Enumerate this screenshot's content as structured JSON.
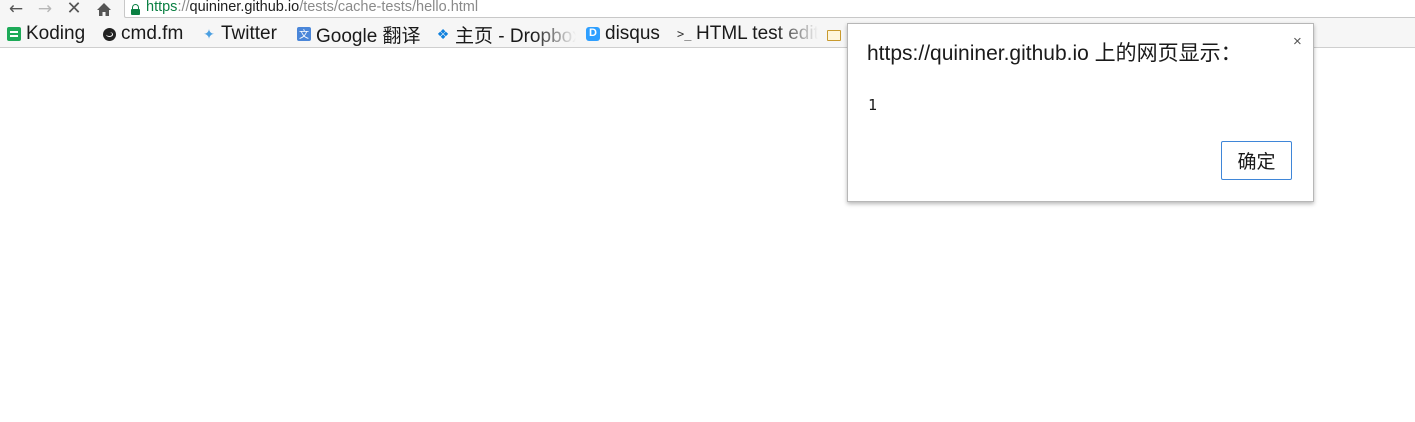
{
  "browser": {
    "nav": {
      "back_icon": "arrow-left-icon",
      "forward_icon": "arrow-right-icon",
      "stop_icon": "close-icon",
      "home_icon": "home-icon"
    },
    "omnibox": {
      "secure_icon": "lock-icon",
      "scheme": "https",
      "separator": "://",
      "host": "quininer.github.io",
      "path": "/tests/cache-tests/hello.html"
    },
    "bookmarks": [
      {
        "label": "Koding",
        "icon": "koding-icon"
      },
      {
        "label": "cmd.fm",
        "icon": "cmd-fm-icon"
      },
      {
        "label": "Twitter",
        "icon": "twitter-icon"
      },
      {
        "label": "Google 翻译",
        "icon": "google-translate-icon"
      },
      {
        "label": "主页 - Dropbox",
        "icon": "dropbox-icon"
      },
      {
        "label": "disqus",
        "icon": "disqus-icon"
      },
      {
        "label": "HTML test editor",
        "icon": "terminal-icon"
      },
      {
        "label": "",
        "icon": "folder-icon"
      }
    ]
  },
  "dialog": {
    "title": "https://quininer.github.io 上的网页显示：",
    "close_glyph": "×",
    "message": "1",
    "ok_label": "确定",
    "accent_color": "#3f86d8"
  }
}
